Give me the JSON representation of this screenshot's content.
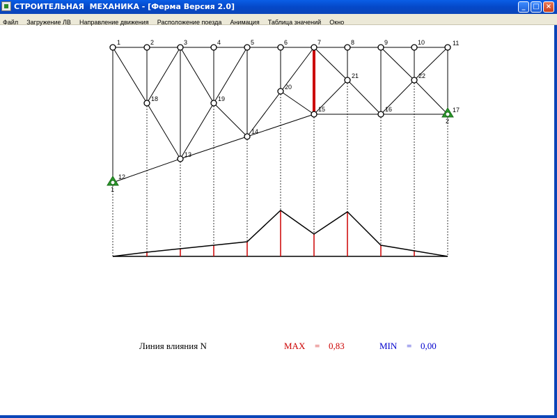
{
  "window": {
    "title": "СТРОИТЕЛЬНАЯ  МЕХАНИКА - [Ферма Версия 2.0]",
    "minimize_glyph": "_",
    "maximize_glyph": "□",
    "close_glyph": "×"
  },
  "menu": [
    "Файл",
    "Загружение ЛВ",
    "Направление движения",
    "Расположение поезда",
    "Анимация",
    "Таблица значений",
    "Окно"
  ],
  "truss": {
    "top_nodes": [
      "1",
      "2",
      "3",
      "4",
      "5",
      "6",
      "7",
      "8",
      "9",
      "10",
      "11"
    ],
    "lower_nodes": [
      "12",
      "13",
      "14",
      "15",
      "16",
      "17"
    ],
    "mid_nodes": [
      "18",
      "19",
      "20",
      "21",
      "22"
    ],
    "support_labels": [
      "1",
      "2"
    ],
    "highlighted_member": "6-7 vertical (7-15)",
    "colors": {
      "member": "#000000",
      "highlight": "#cc0000",
      "support": "#2a9a2a"
    }
  },
  "influence_line": {
    "colors": {
      "line": "#000000",
      "ordinate": "#cc0000"
    }
  },
  "footer": {
    "label": "Линия   влияния   N",
    "max_label": "MAX",
    "max_eq": "=",
    "max_value": "0,83",
    "min_label": "MIN",
    "min_eq": "=",
    "min_value": "0,00",
    "colors": {
      "max": "#cc0000",
      "min": "#0000cc",
      "label": "#000000"
    }
  }
}
